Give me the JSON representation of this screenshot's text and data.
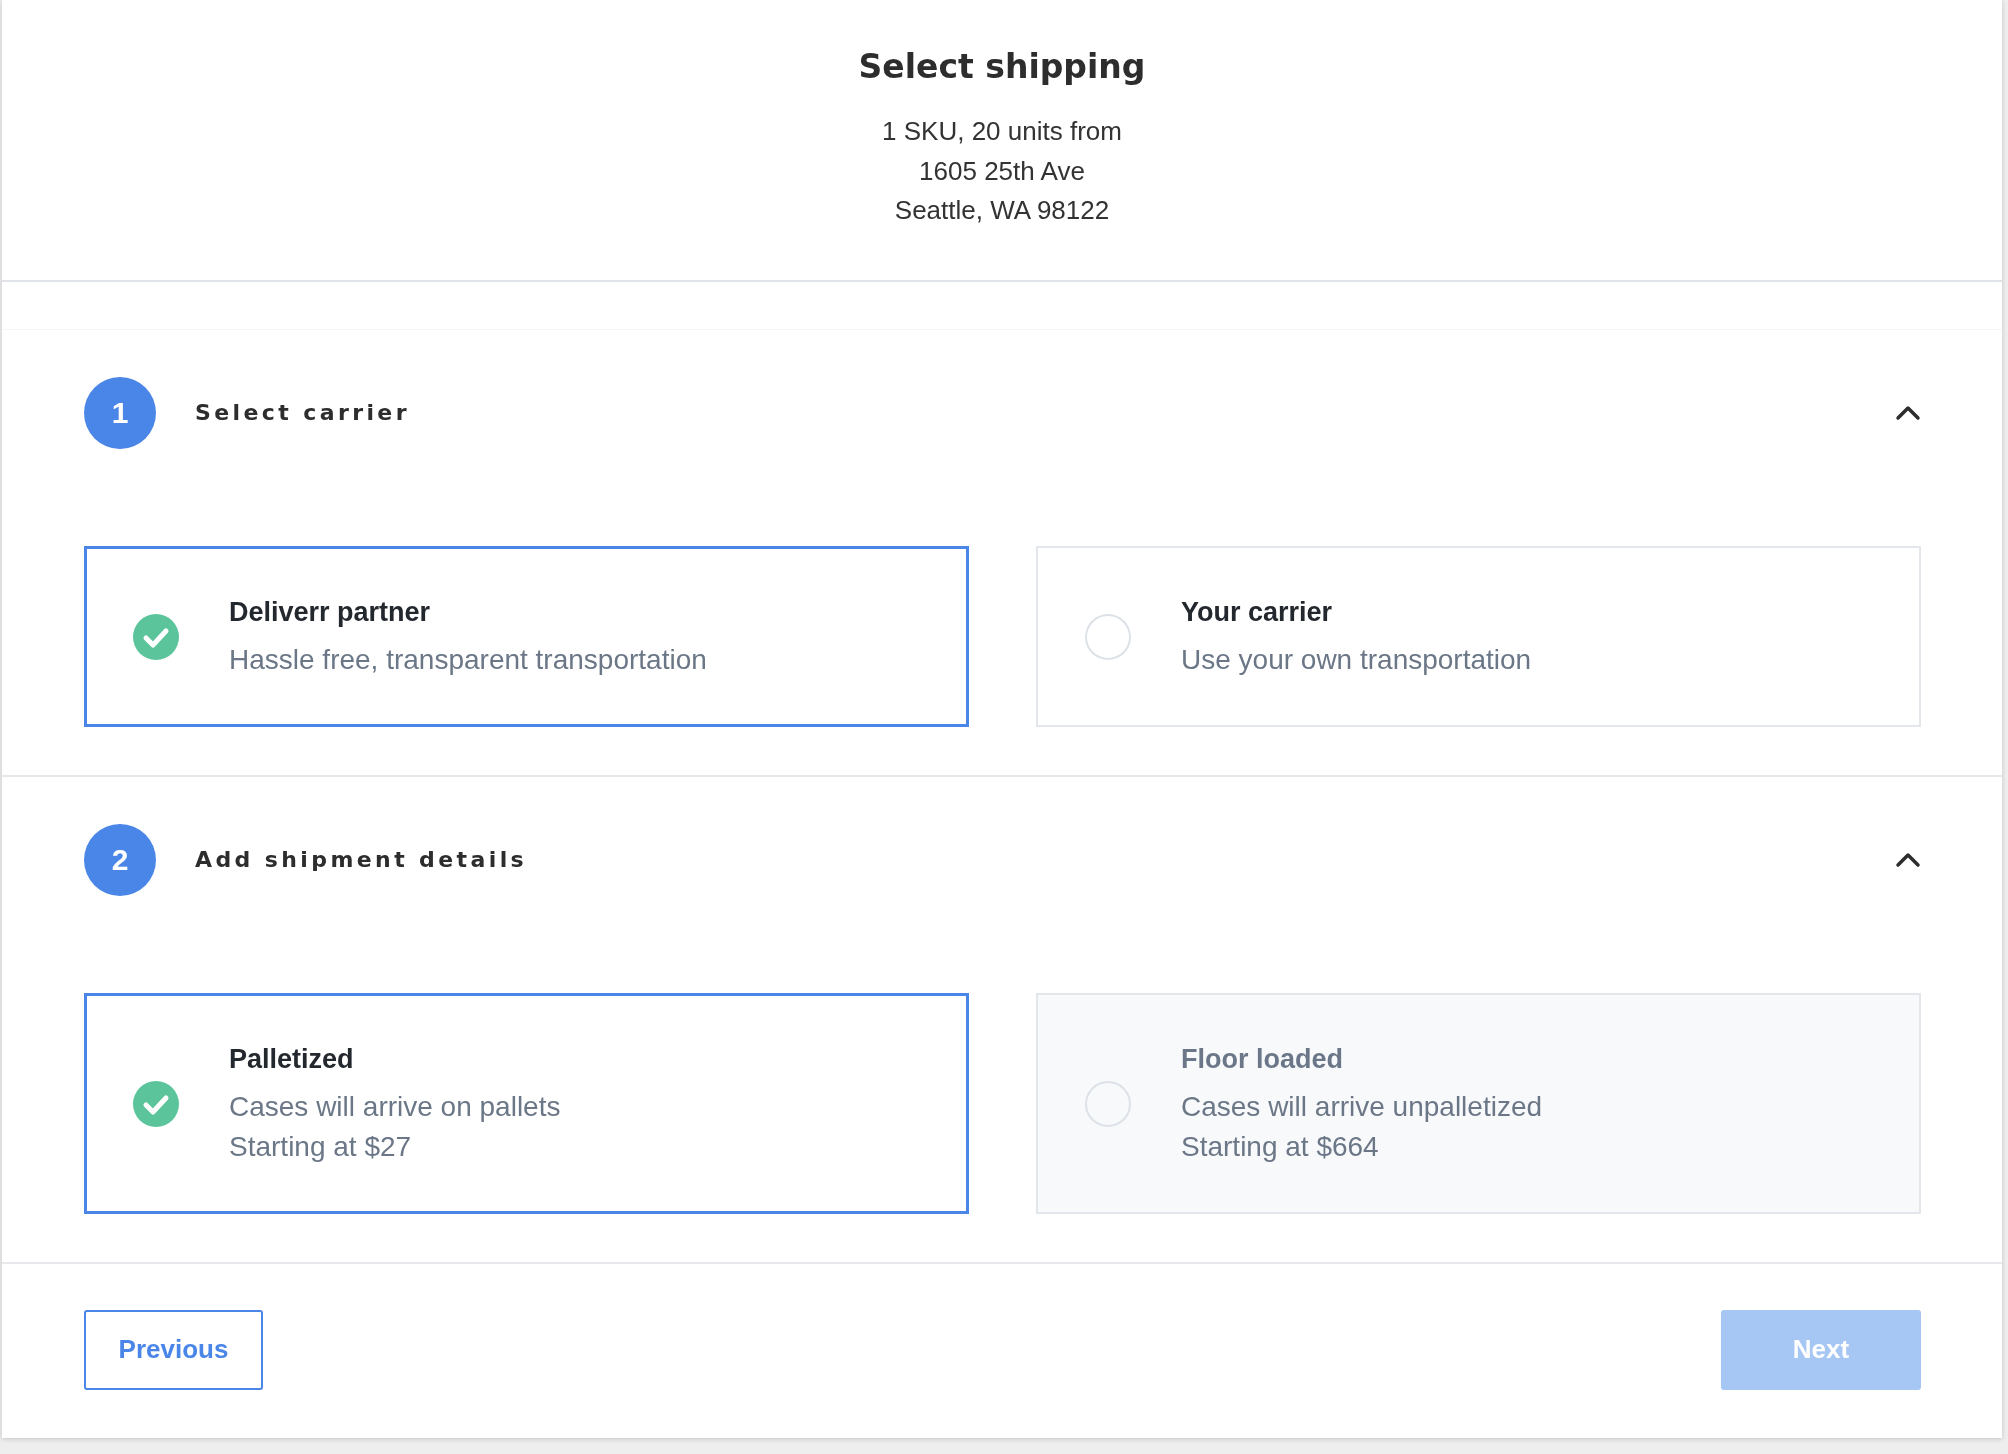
{
  "header": {
    "title": "Select shipping",
    "summary_lines": [
      "1 SKU, 20 units from",
      "1605 25th Ave",
      "Seattle, WA 98122"
    ]
  },
  "steps": [
    {
      "number": "1",
      "title": "Select carrier",
      "expanded": true,
      "options": [
        {
          "title": "Deliverr partner",
          "lines": [
            "Hassle free, transparent transportation"
          ],
          "selected": true,
          "disabled": false
        },
        {
          "title": "Your carrier",
          "lines": [
            "Use your own transportation"
          ],
          "selected": false,
          "disabled": false
        }
      ]
    },
    {
      "number": "2",
      "title": "Add shipment details",
      "expanded": true,
      "options": [
        {
          "title": "Palletized",
          "lines": [
            "Cases will arrive on pallets",
            "Starting at $27"
          ],
          "selected": true,
          "disabled": false
        },
        {
          "title": "Floor loaded",
          "lines": [
            "Cases will arrive unpalletized",
            "Starting at $664"
          ],
          "selected": false,
          "disabled": true
        }
      ]
    }
  ],
  "footer": {
    "previous": {
      "label": "Previous"
    },
    "next": {
      "label": "Next",
      "disabled": true
    }
  }
}
